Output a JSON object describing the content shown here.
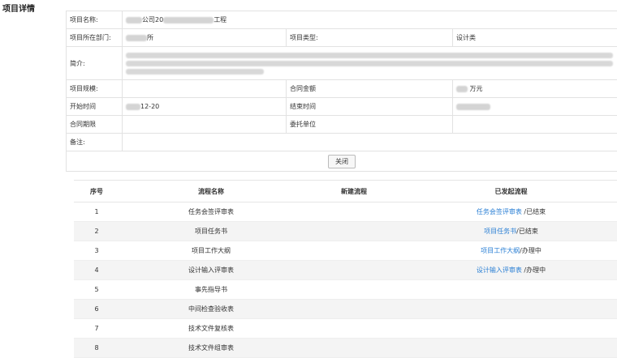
{
  "page_title": "项目详情",
  "details": {
    "project_name_label": "项目名称:",
    "project_name_value": "公司20",
    "project_name_suffix": "工程",
    "department_label": "项目所在部门:",
    "department_value": "所",
    "project_type_label": "项目类型:",
    "project_type_value": "设计类",
    "intro_label": "简介:",
    "scale_label": "项目规模:",
    "contract_amount_label": "合同金额",
    "contract_amount_unit": "万元",
    "start_time_label": "开始时间",
    "start_time_value": "12-20",
    "end_time_label": "结束时间",
    "contract_period_label": "合同期限",
    "client_label": "委托单位",
    "remark_label": "备注:",
    "close_button": "关闭"
  },
  "flow_table": {
    "headers": [
      "序号",
      "流程名称",
      "新建流程",
      "已发起流程"
    ],
    "rows": [
      {
        "no": "1",
        "name": "任务会签评审表",
        "link": "任务会签评审表",
        "status": " /已结束"
      },
      {
        "no": "2",
        "name": "项目任务书",
        "link": "项目任务书",
        "status": "/已结束"
      },
      {
        "no": "3",
        "name": "项目工作大纲",
        "link": "项目工作大纲",
        "status": "/办理中"
      },
      {
        "no": "4",
        "name": "设计输入评审表",
        "link": "设计输入评审表",
        "status": " /办理中"
      },
      {
        "no": "5",
        "name": "事先指导书",
        "link": "",
        "status": ""
      },
      {
        "no": "6",
        "name": "中间检查验收表",
        "link": "",
        "status": ""
      },
      {
        "no": "7",
        "name": "技术文件复核表",
        "link": "",
        "status": ""
      },
      {
        "no": "8",
        "name": "技术文件组审表",
        "link": "",
        "status": ""
      }
    ]
  },
  "colors": {
    "link": "#2a7fd4",
    "row_alt": "#f4f4f4",
    "border": "#e2e2e2"
  }
}
